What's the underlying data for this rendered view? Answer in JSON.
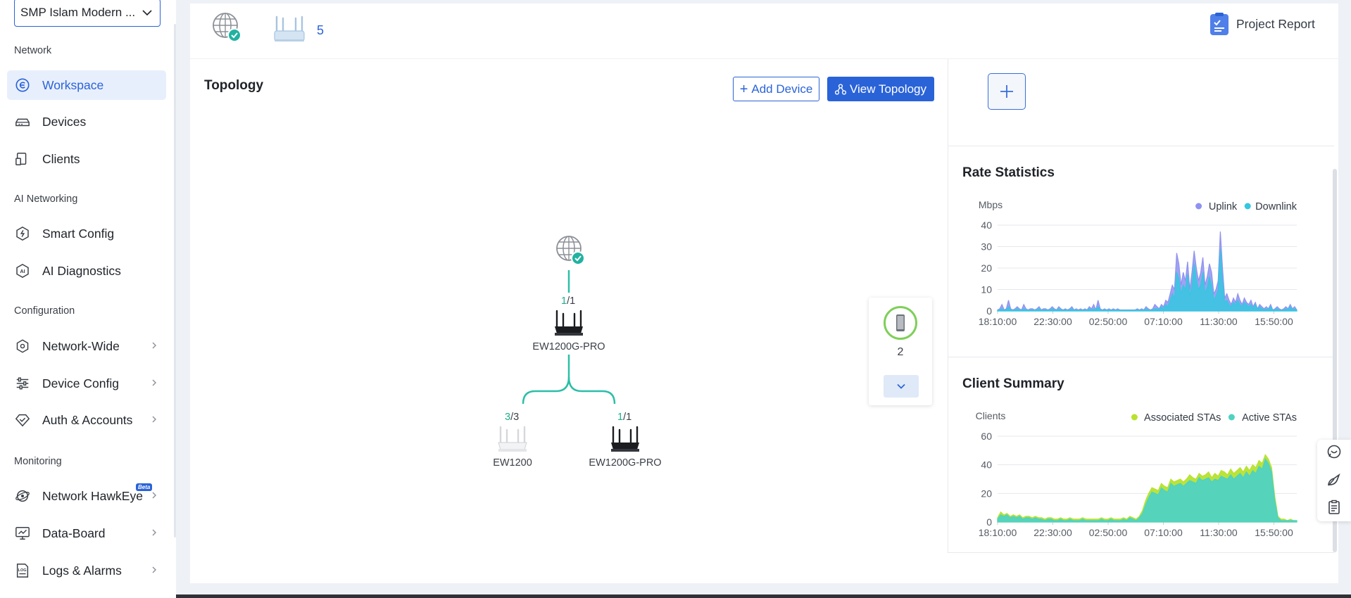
{
  "sidebar": {
    "project": "SMP Islam Modern ...",
    "groups": {
      "network": "Network",
      "ai": "AI Networking",
      "config": "Configuration",
      "monitoring": "Monitoring"
    },
    "items": {
      "workspace": "Workspace",
      "devices": "Devices",
      "clients": "Clients",
      "smart_config": "Smart Config",
      "ai_diagnostics": "AI Diagnostics",
      "network_wide": "Network-Wide",
      "device_config": "Device Config",
      "auth_accounts": "Auth & Accounts",
      "network_hawkeye": "Network HawkEye",
      "beta_badge": "Beta",
      "data_board": "Data-Board",
      "logs_alarms": "Logs & Alarms"
    },
    "active_item": "workspace"
  },
  "header": {
    "device_count": "5",
    "project_report": "Project Report",
    "icons": [
      "internet-globe-icon",
      "router-icon",
      "report-icon"
    ]
  },
  "topology": {
    "title": "Topology",
    "add_device": "Add Device",
    "view_topology": "View Topology",
    "root": {
      "ratio_online": "1",
      "ratio_total": "/1",
      "name": "EW1200G-PRO"
    },
    "children": [
      {
        "ratio_online": "3",
        "ratio_total": "/3",
        "name": "EW1200"
      },
      {
        "ratio_online": "1",
        "ratio_total": "/1",
        "name": "EW1200G-PRO"
      }
    ],
    "clients": {
      "count": "2"
    }
  },
  "colors": {
    "brand": "#2a63d8",
    "uplink": "#8f92f0",
    "downlink": "#35c7e0",
    "associated": "#b7e22e",
    "active": "#4fd2c2",
    "online_green": "#1fb08a"
  },
  "rate_statistics": {
    "title": "Rate Statistics",
    "unit": "Mbps",
    "legend": [
      "Uplink",
      "Downlink"
    ]
  },
  "client_summary": {
    "title": "Client Summary",
    "unit": "Clients",
    "legend": [
      "Associated STAs",
      "Active STAs"
    ]
  },
  "chart_data": [
    {
      "type": "area",
      "title": "Rate Statistics",
      "ylabel": "Mbps",
      "ylim": [
        0,
        40
      ],
      "yticks": [
        0,
        10,
        20,
        30,
        40
      ],
      "xticks": [
        "18:10:00",
        "22:30:00",
        "02:50:00",
        "07:10:00",
        "11:30:00",
        "15:50:00"
      ],
      "legend_position": "top-right",
      "grid": true,
      "series": [
        {
          "name": "Uplink",
          "color": "#8f92f0",
          "values": [
            0.5,
            1,
            3,
            0.5,
            1,
            5,
            1,
            0.5,
            1,
            2,
            1,
            0.5,
            3,
            1,
            0.5,
            1,
            1,
            0.5,
            1,
            2,
            0.5,
            1,
            1,
            0.5,
            1,
            2,
            1,
            0.5,
            2,
            1,
            0.5,
            1,
            0.5,
            1,
            2,
            0.5,
            1,
            0.5,
            1,
            0.5,
            1,
            0.5,
            2,
            1,
            3,
            0.5,
            5,
            1,
            0.5,
            1,
            0.5,
            1,
            0.5,
            1,
            0.5,
            1,
            0.5,
            0.5,
            0.5,
            0.5,
            0.5,
            0.5,
            0.5,
            0.5,
            1,
            0.5,
            1,
            0.5,
            2,
            1,
            0.5,
            1,
            3,
            2,
            1,
            3,
            2,
            5,
            4,
            8,
            12,
            10,
            27,
            22,
            12,
            18,
            14,
            23,
            10,
            18,
            28,
            20,
            14,
            18,
            25,
            12,
            16,
            22,
            18,
            8,
            10,
            14,
            37,
            20,
            6,
            8,
            5,
            3,
            6,
            4,
            8,
            5,
            3,
            6,
            4,
            3,
            5,
            2,
            4,
            1,
            3,
            2,
            1,
            2,
            1,
            3,
            0.5,
            1,
            2,
            1,
            0.5,
            1,
            2,
            1,
            3,
            1,
            2,
            0.5
          ]
        },
        {
          "name": "Downlink",
          "color": "#35c7e0",
          "values": [
            0.3,
            0.5,
            1,
            0.3,
            0.5,
            2,
            0.5,
            0.3,
            0.5,
            1,
            0.5,
            0.3,
            1,
            0.5,
            0.3,
            0.5,
            0.5,
            0.3,
            0.5,
            1,
            0.3,
            0.5,
            0.5,
            0.3,
            0.5,
            1,
            0.5,
            0.3,
            1,
            0.5,
            0.3,
            0.5,
            0.3,
            0.5,
            1,
            0.3,
            0.5,
            0.3,
            0.5,
            0.3,
            0.5,
            0.3,
            1,
            0.5,
            1,
            0.3,
            2,
            0.5,
            0.3,
            0.5,
            0.3,
            0.5,
            0.3,
            0.5,
            0.3,
            0.5,
            0.3,
            0.3,
            0.3,
            0.3,
            0.3,
            0.3,
            0.3,
            0.3,
            0.5,
            0.3,
            0.5,
            0.3,
            1,
            0.5,
            0.3,
            0.5,
            1,
            1,
            0.5,
            2,
            1,
            3,
            2,
            5,
            8,
            6,
            18,
            15,
            8,
            12,
            10,
            17,
            7,
            12,
            22,
            15,
            10,
            12,
            18,
            8,
            11,
            16,
            12,
            5,
            7,
            10,
            29,
            14,
            4,
            5,
            3,
            2,
            4,
            3,
            5,
            3,
            2,
            4,
            3,
            2,
            3,
            1,
            3,
            0.5,
            2,
            1,
            0.5,
            1,
            0.5,
            2,
            0.3,
            0.5,
            1,
            0.5,
            0.3,
            0.5,
            1,
            0.5,
            2,
            0.5,
            1,
            0.3
          ]
        }
      ]
    },
    {
      "type": "area",
      "title": "Client Summary",
      "ylabel": "Clients",
      "ylim": [
        0,
        60
      ],
      "yticks": [
        0,
        20,
        40,
        60
      ],
      "xticks": [
        "18:10:00",
        "22:30:00",
        "02:50:00",
        "07:10:00",
        "11:30:00",
        "15:50:00"
      ],
      "legend_position": "top-right",
      "grid": true,
      "series": [
        {
          "name": "Associated STAs",
          "color": "#b7e22e",
          "values": [
            3,
            7,
            5,
            6,
            4,
            5,
            4,
            5,
            3,
            4,
            4,
            3,
            4,
            3,
            3,
            2,
            3,
            3,
            2,
            2,
            3,
            2,
            2,
            3,
            2,
            2,
            2,
            3,
            2,
            2,
            2,
            2,
            2,
            3,
            2,
            2,
            3,
            2,
            2,
            2,
            3,
            2,
            4,
            3,
            2,
            4,
            8,
            15,
            20,
            24,
            23,
            22,
            27,
            25,
            24,
            30,
            28,
            29,
            30,
            28,
            30,
            33,
            31,
            30,
            34,
            32,
            33,
            35,
            31,
            34,
            32,
            36,
            35,
            33,
            37,
            34,
            36,
            38,
            35,
            39,
            36,
            40,
            38,
            43,
            41,
            47,
            44,
            38,
            18,
            4,
            2,
            2,
            1,
            2,
            1,
            1
          ]
        },
        {
          "name": "Active STAs",
          "color": "#4fd2c2",
          "values": [
            2,
            5,
            4,
            5,
            3,
            4,
            3,
            4,
            2,
            3,
            3,
            2,
            3,
            2,
            2,
            1,
            2,
            2,
            1,
            1,
            2,
            1,
            1,
            2,
            1,
            1,
            1,
            2,
            1,
            1,
            1,
            1,
            1,
            2,
            1,
            1,
            2,
            1,
            1,
            1,
            2,
            1,
            3,
            2,
            1,
            3,
            6,
            12,
            17,
            21,
            20,
            19,
            24,
            22,
            21,
            27,
            25,
            26,
            27,
            25,
            27,
            29,
            28,
            27,
            31,
            29,
            30,
            31,
            28,
            30,
            29,
            32,
            31,
            30,
            33,
            30,
            32,
            34,
            31,
            35,
            32,
            36,
            34,
            39,
            37,
            44,
            41,
            35,
            15,
            3,
            1,
            1,
            1,
            1,
            1,
            1
          ]
        }
      ]
    }
  ]
}
